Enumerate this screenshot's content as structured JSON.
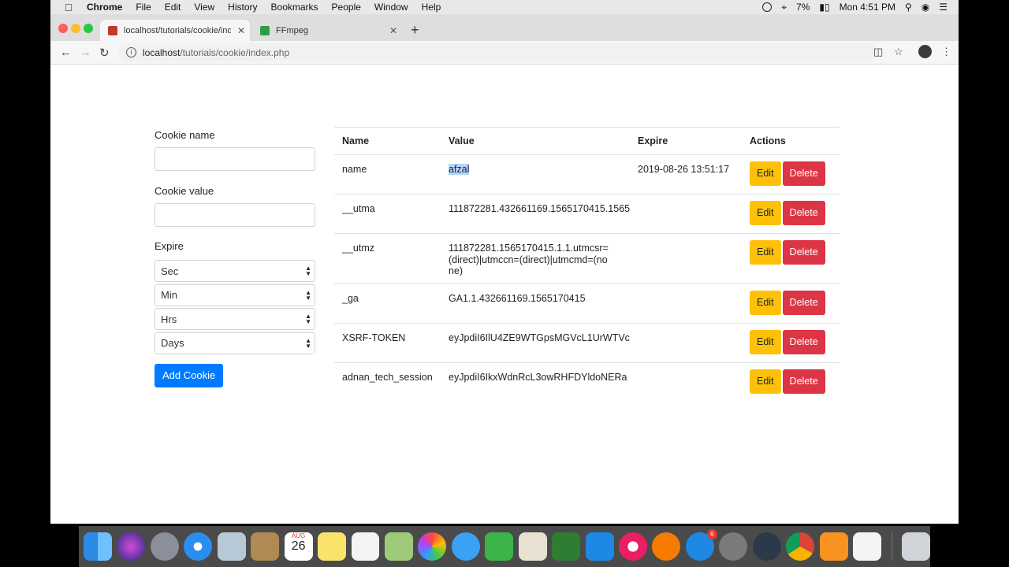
{
  "menubar": {
    "apple": "",
    "items": [
      "Chrome",
      "File",
      "Edit",
      "View",
      "History",
      "Bookmarks",
      "People",
      "Window",
      "Help"
    ],
    "battery": "7%",
    "clock": "Mon 4:51 PM"
  },
  "browser": {
    "tabs": [
      {
        "title": "localhost/tutorials/cookie/inde",
        "favicon_color": "#c0392b"
      },
      {
        "title": "FFmpeg",
        "favicon_color": "#2e9e44"
      }
    ],
    "url_host": "localhost",
    "url_path": "/tutorials/cookie/index.php"
  },
  "form": {
    "cookie_name_label": "Cookie name",
    "cookie_name_value": "",
    "cookie_value_label": "Cookie value",
    "cookie_value_value": "",
    "expire_label": "Expire",
    "selects": [
      "Sec",
      "Min",
      "Hrs",
      "Days"
    ],
    "add_button": "Add Cookie"
  },
  "table": {
    "headers": [
      "Name",
      "Value",
      "Expire",
      "Actions"
    ],
    "rows": [
      {
        "name": "name",
        "value": "afzal",
        "expire": "2019-08-26 13:51:17"
      },
      {
        "name": "__utma",
        "value": "111872281.432661169.1565170415.1565",
        "expire": ""
      },
      {
        "name": "__utmz",
        "value": "111872281.1565170415.1.1.utmcsr=(direct)|utmccn=(direct)|utmcmd=(none)",
        "expire": ""
      },
      {
        "name": "_ga",
        "value": "GA1.1.432661169.1565170415",
        "expire": ""
      },
      {
        "name": "XSRF-TOKEN",
        "value": "eyJpdiI6IlU4ZE9WTGpsMGVcL1UrWTVc",
        "expire": ""
      },
      {
        "name": "adnan_tech_session",
        "value": "eyJpdiI6IkxWdnRcL3owRHFDYldoNERa",
        "expire": ""
      }
    ],
    "edit_label": "Edit",
    "delete_label": "Delete"
  },
  "dock": {
    "calendar_month": "AUG",
    "calendar_day": "26",
    "appstore_badge": "6"
  }
}
